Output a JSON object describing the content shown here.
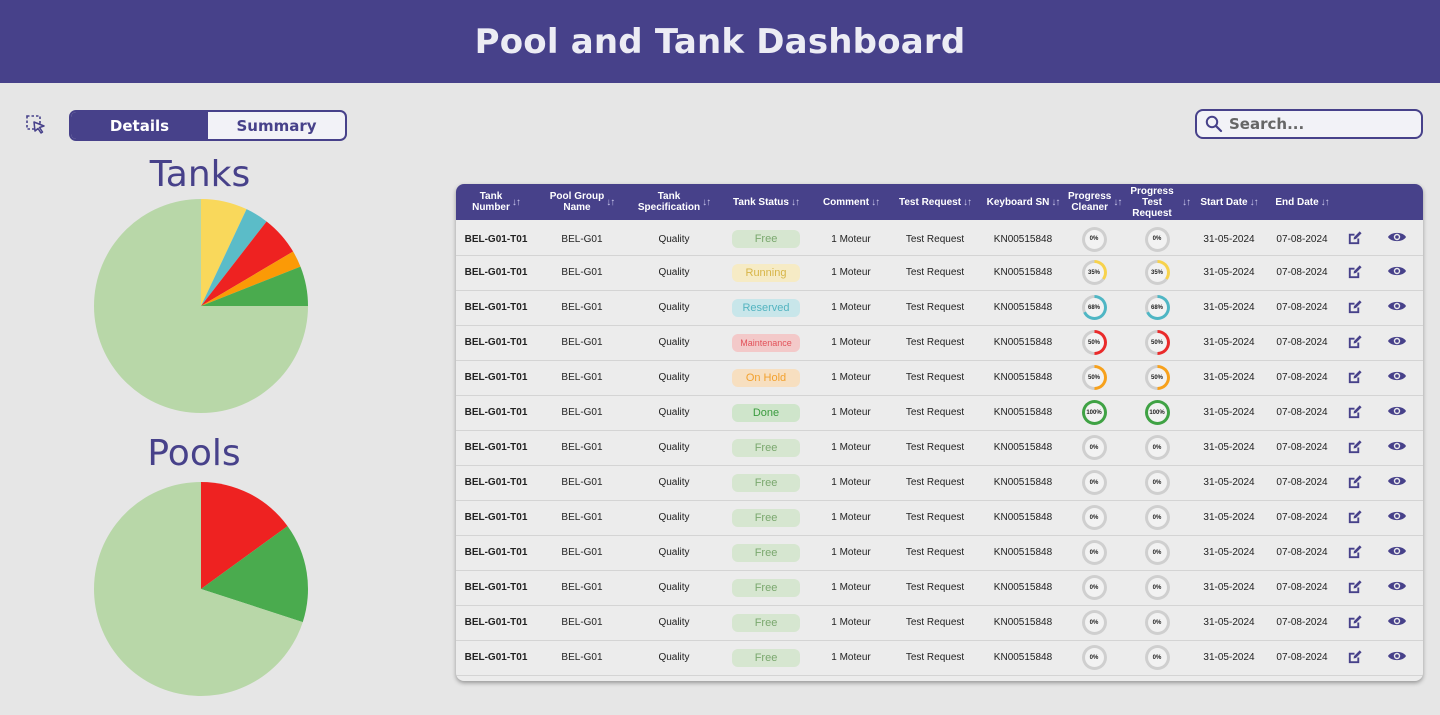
{
  "header": {
    "title": "Pool and Tank Dashboard"
  },
  "toolbar": {
    "details_label": "Details",
    "summary_label": "Summary",
    "active_tab": "Details"
  },
  "search": {
    "placeholder": "Search..."
  },
  "charts": {
    "tanks_title": "Tanks",
    "pools_title": "Pools"
  },
  "chart_data": [
    {
      "type": "pie",
      "title": "Tanks",
      "slices": [
        {
          "value": 7,
          "color": "#f9d85b"
        },
        {
          "value": 3.5,
          "color": "#5bbcc8"
        },
        {
          "value": 6,
          "color": "#ee2221"
        },
        {
          "value": 2.5,
          "color": "#fb9a06"
        },
        {
          "value": 6,
          "color": "#4aab4e"
        },
        {
          "value": 75,
          "color": "#b8d7a8"
        }
      ]
    },
    {
      "type": "pie",
      "title": "Pools",
      "slices": [
        {
          "value": 15,
          "color": "#ee2221"
        },
        {
          "value": 15,
          "color": "#4aab4e"
        },
        {
          "value": 70,
          "color": "#b8d7a8"
        }
      ]
    }
  ],
  "table": {
    "columns": [
      {
        "label": "Tank\nNumber"
      },
      {
        "label": "Pool Group\nName"
      },
      {
        "label": "Tank\nSpecification"
      },
      {
        "label": "Tank Status"
      },
      {
        "label": "Comment"
      },
      {
        "label": "Test Request"
      },
      {
        "label": "Keyboard SN"
      },
      {
        "label": "Progress\nCleaner"
      },
      {
        "label": "Progress\nTest Request"
      },
      {
        "label": "Start Date"
      },
      {
        "label": "End Date"
      }
    ],
    "status_styles": {
      "Free": {
        "bg": "#d6e6d0",
        "fg": "#7aa86e"
      },
      "Running": {
        "bg": "#f6ebc5",
        "fg": "#d7b548"
      },
      "Reserved": {
        "bg": "#c8e6ea",
        "fg": "#54b4c0"
      },
      "Maintenance": {
        "bg": "#f3c9c9",
        "fg": "#e2525a"
      },
      "On Hold": {
        "bg": "#f7dfc0",
        "fg": "#f2a12e"
      },
      "Done": {
        "bg": "#cfe5cb",
        "fg": "#3a9b3e"
      }
    },
    "rows": [
      {
        "tank_number": "BEL-G01-T01",
        "pool_group": "BEL-G01",
        "spec": "Quality",
        "status": "Free",
        "comment": "1 Moteur",
        "test_request": "Test Request",
        "keyboard_sn": "KN00515848",
        "progress_cleaner": "0%",
        "progress_cleaner_value": 0,
        "progress_test": "0%",
        "progress_test_value": 0,
        "progress_color": "#cccccc",
        "start_date": "31-05-2024",
        "end_date": "07-08-2024"
      },
      {
        "tank_number": "BEL-G01-T01",
        "pool_group": "BEL-G01",
        "spec": "Quality",
        "status": "Running",
        "comment": "1 Moteur",
        "test_request": "Test Request",
        "keyboard_sn": "KN00515848",
        "progress_cleaner": "35%",
        "progress_cleaner_value": 35,
        "progress_test": "35%",
        "progress_test_value": 35,
        "progress_color": "#f7d24c",
        "start_date": "31-05-2024",
        "end_date": "07-08-2024"
      },
      {
        "tank_number": "BEL-G01-T01",
        "pool_group": "BEL-G01",
        "spec": "Quality",
        "status": "Reserved",
        "comment": "1 Moteur",
        "test_request": "Test Request",
        "keyboard_sn": "KN00515848",
        "progress_cleaner": "68%",
        "progress_cleaner_value": 68,
        "progress_test": "68%",
        "progress_test_value": 68,
        "progress_color": "#4fb6c4",
        "start_date": "31-05-2024",
        "end_date": "07-08-2024"
      },
      {
        "tank_number": "BEL-G01-T01",
        "pool_group": "BEL-G01",
        "spec": "Quality",
        "status": "Maintenance",
        "comment": "1 Moteur",
        "test_request": "Test Request",
        "keyboard_sn": "KN00515848",
        "progress_cleaner": "50%",
        "progress_cleaner_value": 50,
        "progress_test": "50%",
        "progress_test_value": 50,
        "progress_color": "#ea2a2a",
        "start_date": "31-05-2024",
        "end_date": "07-08-2024"
      },
      {
        "tank_number": "BEL-G01-T01",
        "pool_group": "BEL-G01",
        "spec": "Quality",
        "status": "On Hold",
        "comment": "1 Moteur",
        "test_request": "Test Request",
        "keyboard_sn": "KN00515848",
        "progress_cleaner": "50%",
        "progress_cleaner_value": 50,
        "progress_test": "50%",
        "progress_test_value": 50,
        "progress_color": "#f7a11c",
        "start_date": "31-05-2024",
        "end_date": "07-08-2024"
      },
      {
        "tank_number": "BEL-G01-T01",
        "pool_group": "BEL-G01",
        "spec": "Quality",
        "status": "Done",
        "comment": "1 Moteur",
        "test_request": "Test Request",
        "keyboard_sn": "KN00515848",
        "progress_cleaner": "100%",
        "progress_cleaner_value": 100,
        "progress_test": "100%",
        "progress_test_value": 100,
        "progress_color": "#3fa244",
        "start_date": "31-05-2024",
        "end_date": "07-08-2024"
      },
      {
        "tank_number": "BEL-G01-T01",
        "pool_group": "BEL-G01",
        "spec": "Quality",
        "status": "Free",
        "comment": "1 Moteur",
        "test_request": "Test Request",
        "keyboard_sn": "KN00515848",
        "progress_cleaner": "0%",
        "progress_cleaner_value": 0,
        "progress_test": "0%",
        "progress_test_value": 0,
        "progress_color": "#cccccc",
        "start_date": "31-05-2024",
        "end_date": "07-08-2024"
      },
      {
        "tank_number": "BEL-G01-T01",
        "pool_group": "BEL-G01",
        "spec": "Quality",
        "status": "Free",
        "comment": "1 Moteur",
        "test_request": "Test Request",
        "keyboard_sn": "KN00515848",
        "progress_cleaner": "0%",
        "progress_cleaner_value": 0,
        "progress_test": "0%",
        "progress_test_value": 0,
        "progress_color": "#cccccc",
        "start_date": "31-05-2024",
        "end_date": "07-08-2024"
      },
      {
        "tank_number": "BEL-G01-T01",
        "pool_group": "BEL-G01",
        "spec": "Quality",
        "status": "Free",
        "comment": "1 Moteur",
        "test_request": "Test Request",
        "keyboard_sn": "KN00515848",
        "progress_cleaner": "0%",
        "progress_cleaner_value": 0,
        "progress_test": "0%",
        "progress_test_value": 0,
        "progress_color": "#cccccc",
        "start_date": "31-05-2024",
        "end_date": "07-08-2024"
      },
      {
        "tank_number": "BEL-G01-T01",
        "pool_group": "BEL-G01",
        "spec": "Quality",
        "status": "Free",
        "comment": "1 Moteur",
        "test_request": "Test Request",
        "keyboard_sn": "KN00515848",
        "progress_cleaner": "0%",
        "progress_cleaner_value": 0,
        "progress_test": "0%",
        "progress_test_value": 0,
        "progress_color": "#cccccc",
        "start_date": "31-05-2024",
        "end_date": "07-08-2024"
      },
      {
        "tank_number": "BEL-G01-T01",
        "pool_group": "BEL-G01",
        "spec": "Quality",
        "status": "Free",
        "comment": "1 Moteur",
        "test_request": "Test Request",
        "keyboard_sn": "KN00515848",
        "progress_cleaner": "0%",
        "progress_cleaner_value": 0,
        "progress_test": "0%",
        "progress_test_value": 0,
        "progress_color": "#cccccc",
        "start_date": "31-05-2024",
        "end_date": "07-08-2024"
      },
      {
        "tank_number": "BEL-G01-T01",
        "pool_group": "BEL-G01",
        "spec": "Quality",
        "status": "Free",
        "comment": "1 Moteur",
        "test_request": "Test Request",
        "keyboard_sn": "KN00515848",
        "progress_cleaner": "0%",
        "progress_cleaner_value": 0,
        "progress_test": "0%",
        "progress_test_value": 0,
        "progress_color": "#cccccc",
        "start_date": "31-05-2024",
        "end_date": "07-08-2024"
      },
      {
        "tank_number": "BEL-G01-T01",
        "pool_group": "BEL-G01",
        "spec": "Quality",
        "status": "Free",
        "comment": "1 Moteur",
        "test_request": "Test Request",
        "keyboard_sn": "KN00515848",
        "progress_cleaner": "0%",
        "progress_cleaner_value": 0,
        "progress_test": "0%",
        "progress_test_value": 0,
        "progress_color": "#cccccc",
        "start_date": "31-05-2024",
        "end_date": "07-08-2024"
      }
    ]
  },
  "icons": {
    "select": "pointer-select-icon",
    "search": "search-icon",
    "edit": "edit-icon",
    "view": "eye-icon",
    "sort": "sort-icon"
  },
  "colors": {
    "primary": "#47418a",
    "background": "#e6e6e6"
  }
}
